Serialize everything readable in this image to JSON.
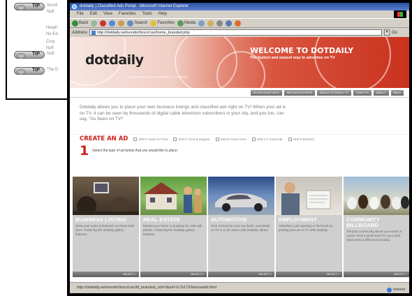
{
  "back_window": {
    "rows": [
      {
        "badge": "TIP",
        "text": [
          "Scroll",
          "Nufi"
        ]
      },
      {
        "badge": "",
        "text": [
          "Headl",
          "No Ed"
        ]
      },
      {
        "badge": "",
        "text": [
          "Cory",
          "Nufi"
        ]
      },
      {
        "badge": "TIP",
        "text": [
          "Nufi",
          ""
        ]
      },
      {
        "badge": "TIP",
        "text": [
          "The D",
          ""
        ]
      }
    ]
  },
  "browser": {
    "title": "dotdaily | Classified Ads Portal - Microsoft Internet Explorer",
    "menu": [
      "File",
      "Edit",
      "View",
      "Favorites",
      "Tools",
      "Help"
    ],
    "toolbar": [
      "Back",
      "",
      "",
      "",
      "",
      "Search",
      "Favorites",
      "Media",
      "",
      "",
      "",
      "",
      ""
    ],
    "address_label": "Address",
    "address_value": "http://dotdaily.net/vendor/brscd.iso/home_branded.php",
    "go_label": "Go",
    "status_text": "http://dotdaily.net/vendor/brscd.iso/bl_branded_cid=2&sd=1c7k17X/lesicreatd.html",
    "zone_text": "Internet"
  },
  "site": {
    "logo": "dotdaily",
    "tagline": "THE WORLD OF INTERNET CHANNEL",
    "welcome": "WELCOME TO DOTDAILY",
    "welcome_sub": "The fastest and easiest way to advertise on TV",
    "nav": [
      "MY ACCOUNT INFO",
      "SEE ADS/LISTINGS",
      "ABOUT DOTDAILY TV",
      "HOW IT'S",
      "ABOUT",
      "HELP"
    ],
    "intro": "Dotdaily allows you to place your own business listings and classified ads right on TV! When your ad is on TV, it can be seen by thousands of digital cable television subscribers in your city, and you too, can say, \"As Seen on TV!\"",
    "create_title": "CREATE AN AD",
    "create_options": [
      "SEE'S Value for Fast",
      "SEE'S Tried & Regular",
      "SEE'S Article Here",
      "SEE'S 4 Subscript",
      "SEE'S Blessed"
    ],
    "step_number": "1",
    "step_text": "Select the type of ad below that you would like to place:",
    "categories": [
      {
        "title": "BUSINESS LISTING",
        "desc": "Grow your sales & business on these Web sites. Featuring the dotdaily gallery features.",
        "more": "SELECT >"
      },
      {
        "title": "REAL ESTATE",
        "desc": "Market your home or property for sale with photos. Featuring the dotdaily gallery features.",
        "more": "SELECT >"
      },
      {
        "title": "AUTOMOTIVE",
        "desc": "Give a boost for your car deals, everybody on TV is a car owner with dotdaily values.",
        "more": "SELECT >"
      },
      {
        "title": "EMPLOYMENT",
        "desc": "Advertise a job opening or find work by posting your ad on TV with dotdaily.",
        "more": "SELECT >"
      },
      {
        "title": "COMMUNITY BILLBOARD",
        "desc": "Tell your community about your event or cause. Find a good home for your pets. Sponsored a billboard ad today.",
        "more": "SELECT >"
      }
    ]
  }
}
